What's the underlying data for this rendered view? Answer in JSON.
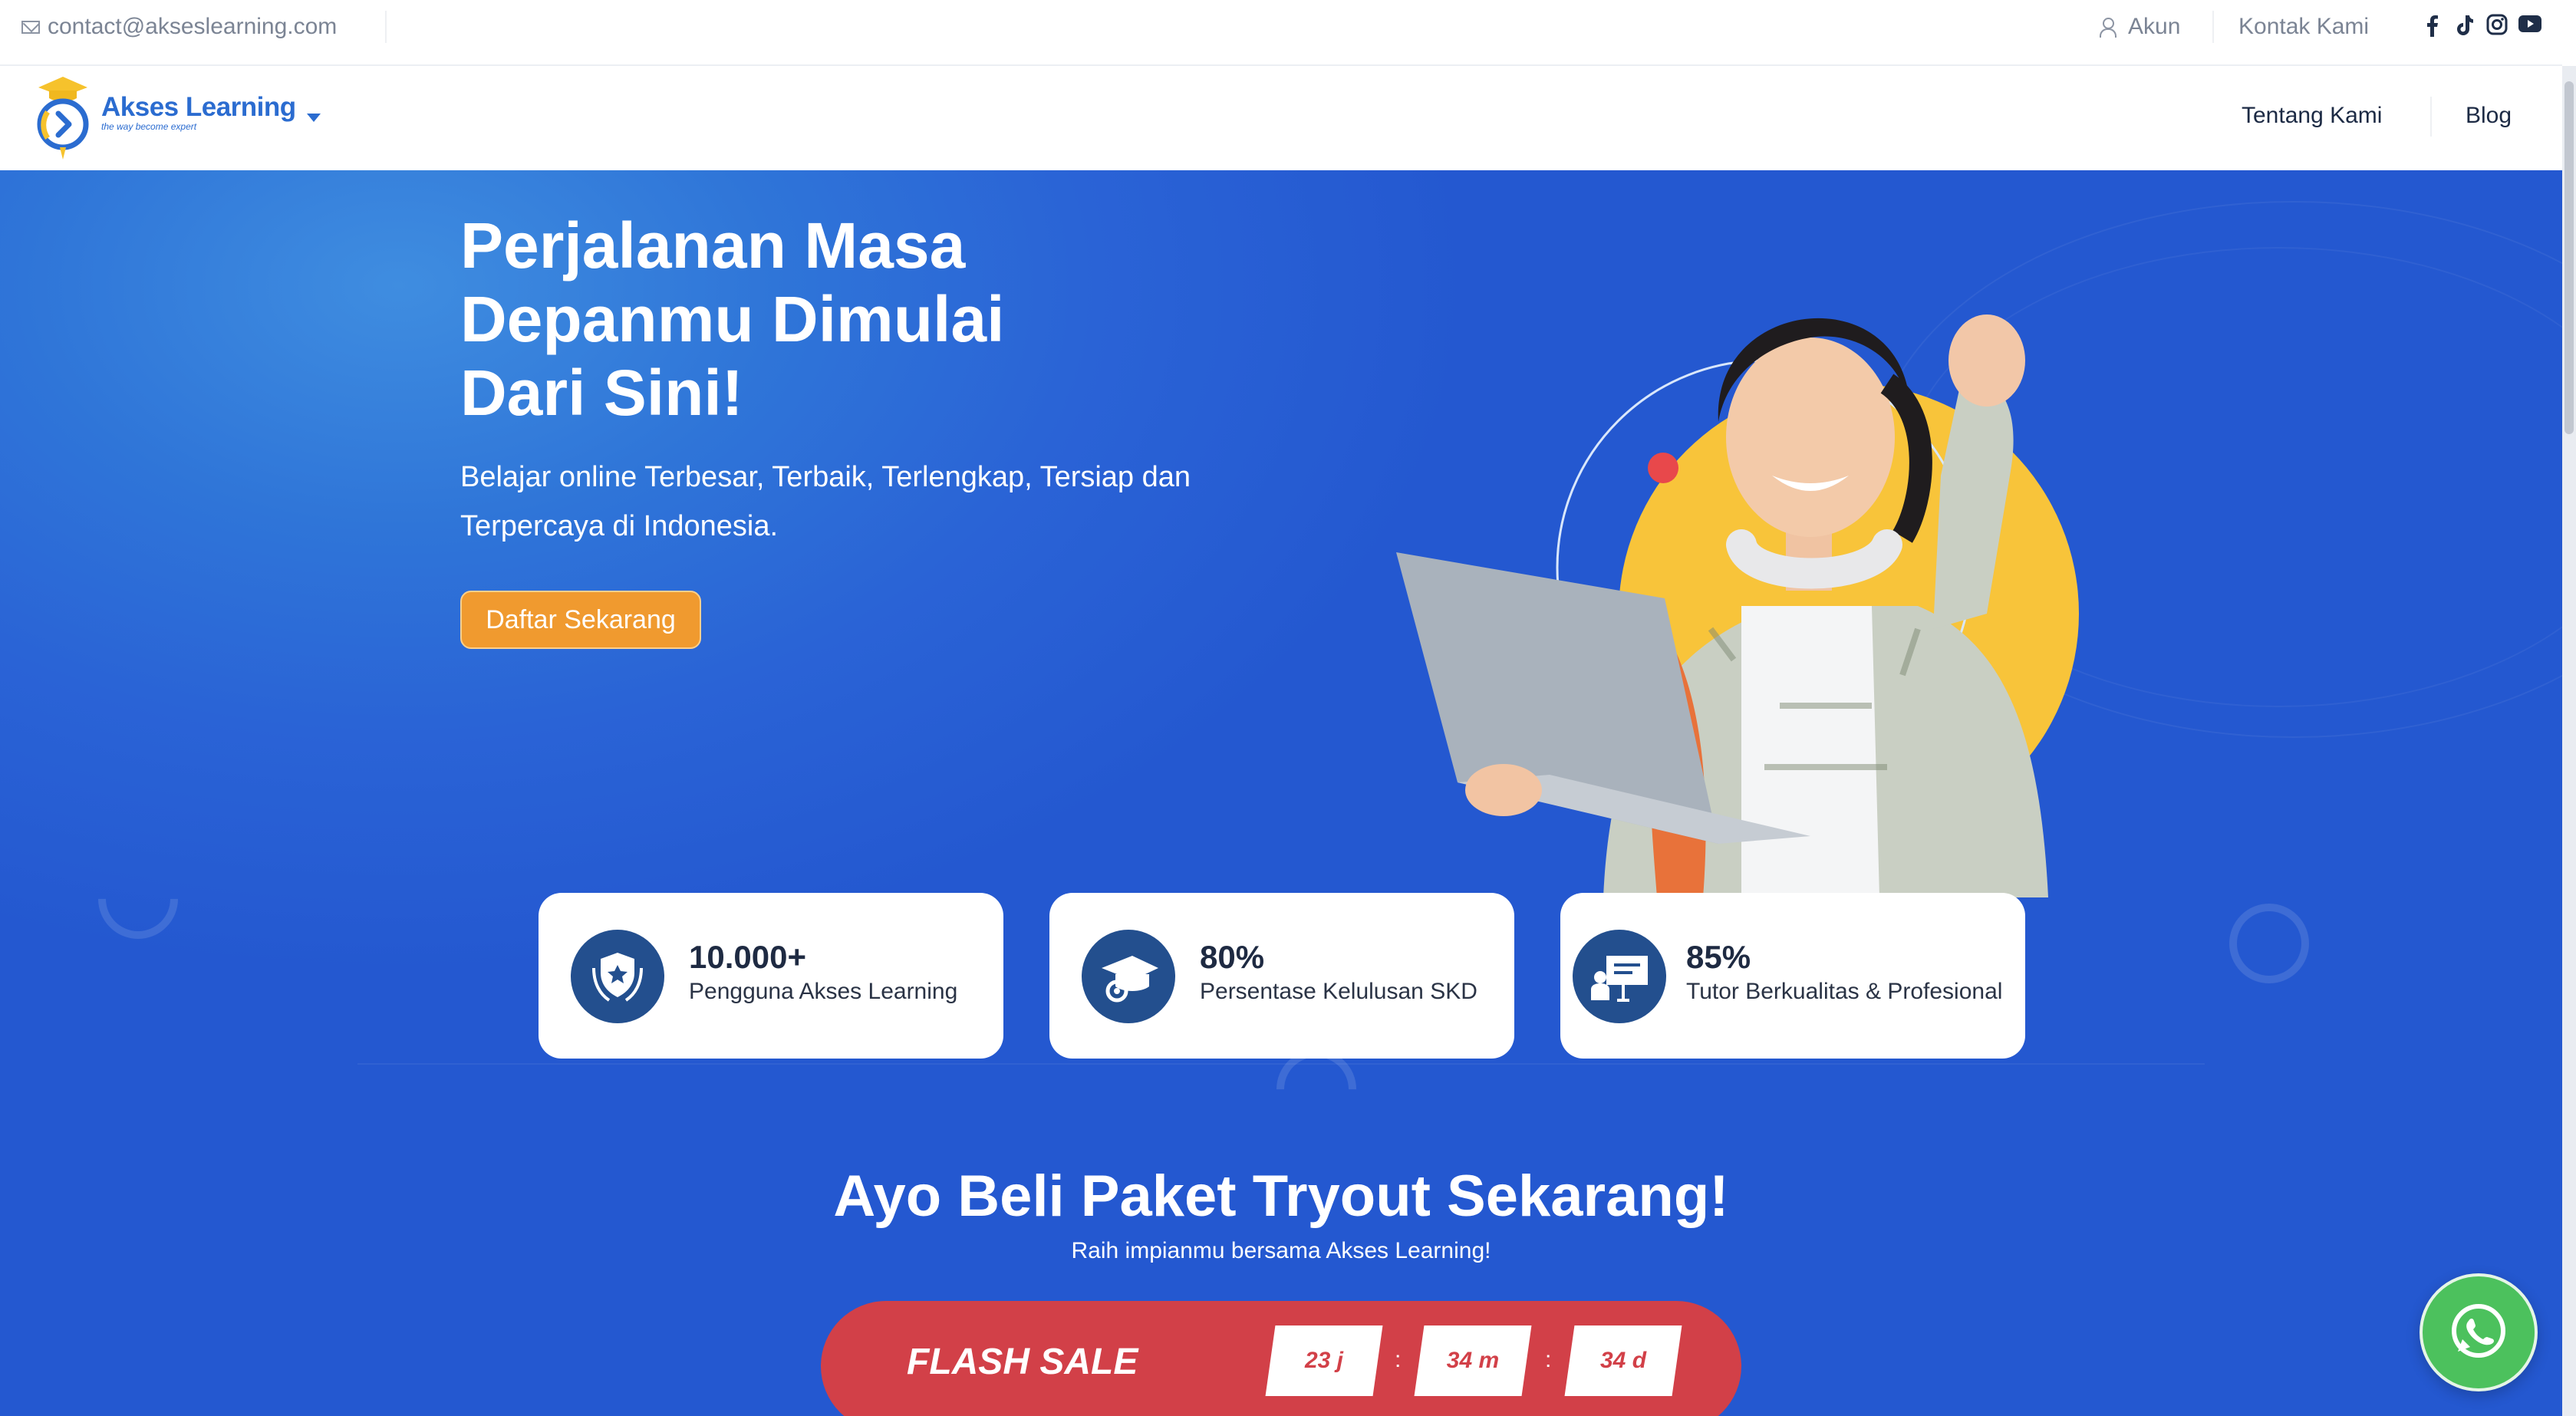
{
  "topbar": {
    "email": "contact@akseslearning.com",
    "account_label": "Akun",
    "contact_label": "Kontak Kami",
    "social_icons": [
      "facebook-icon",
      "tiktok-icon",
      "instagram-icon",
      "youtube-icon"
    ]
  },
  "navbar": {
    "brand_name": "Akses Learning",
    "brand_tagline": "the way become expert",
    "links": [
      "Tentang Kami",
      "Blog"
    ]
  },
  "hero": {
    "title_lines": [
      "Perjalanan Masa",
      "Depanmu Dimulai",
      "Dari Sini!"
    ],
    "subtitle_lines": [
      "Belajar online Terbesar, Terbaik, Terlengkap, Tersiap dan",
      "Terpercaya di Indonesia."
    ],
    "cta_label": "Daftar Sekarang"
  },
  "stats": [
    {
      "value": "10.000+",
      "label": "Pengguna Akses Learning",
      "icon": "award-badge-icon"
    },
    {
      "value": "80%",
      "label": "Persentase Kelulusan SKD",
      "icon": "graduation-cap-icon"
    },
    {
      "value": "85%",
      "label": "Tutor Berkualitas & Profesional",
      "icon": "teacher-board-icon"
    }
  ],
  "tryout": {
    "title": "Ayo Beli Paket Tryout Sekarang!",
    "subtitle": "Raih impianmu bersama Akses Learning!"
  },
  "flash_sale": {
    "label": "FLASH SALE",
    "countdown": [
      "23 j",
      "34 m",
      "34 d"
    ],
    "separator": ":"
  },
  "colors": {
    "brand_blue": "#2b6cd0",
    "hero_blue": "#2a63d6",
    "cta_orange": "#f09a2f",
    "flash_red": "#d24048",
    "whatsapp_green": "#4cc15d"
  }
}
